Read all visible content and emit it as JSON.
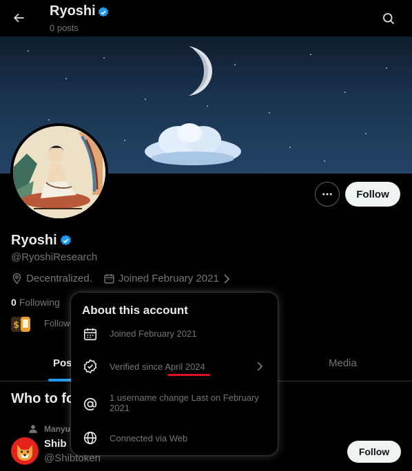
{
  "header": {
    "name": "Ryoshi",
    "posts": "0 posts"
  },
  "profile": {
    "name": "Ryoshi",
    "handle": "@RyoshiResearch",
    "location": "Decentralized.",
    "joined": "Joined February 2021",
    "following_count": "0",
    "following_label": "Following",
    "followed_by": "Follow",
    "follow_label": "Follow",
    "more_label": "More"
  },
  "tabs": {
    "posts": "Pos",
    "media": "Media"
  },
  "who_to_follow": {
    "title": "Who to fo",
    "followed_by": "Manyu",
    "suggestion": {
      "name": "Shib",
      "handle": "@Shibtoken",
      "follow_label": "Follow"
    }
  },
  "about_popover": {
    "title": "About this account",
    "rows": [
      {
        "icon": "calendar-icon",
        "text": "Joined February 2021"
      },
      {
        "icon": "verified-badge-icon",
        "text": "Verified since April 2024"
      },
      {
        "icon": "at-sign-icon",
        "text": "1 username change Last on February 2021"
      },
      {
        "icon": "globe-icon",
        "text": "Connected via Web"
      }
    ]
  },
  "colors": {
    "accent": "#1d9bf0",
    "muted": "#71767b",
    "underline": "#e0121d"
  }
}
